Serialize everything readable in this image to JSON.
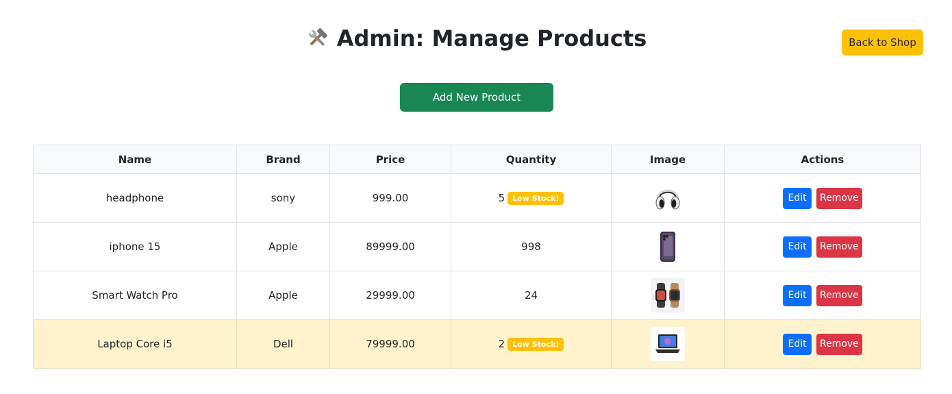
{
  "header": {
    "title": "Admin: Manage Products",
    "icon": "hammer-and-wrench-icon",
    "back_label": "Back to Shop"
  },
  "toolbar": {
    "add_label": "Add New Product"
  },
  "table": {
    "columns": [
      "Name",
      "Brand",
      "Price",
      "Quantity",
      "Image",
      "Actions"
    ],
    "rows": [
      {
        "name": "headphone",
        "brand": "sony",
        "price": "999.00",
        "quantity": "5",
        "badge": "Low Stock!",
        "image": "headphone-image",
        "edit": "Edit",
        "remove": "Remove"
      },
      {
        "name": "iphone 15",
        "brand": "Apple",
        "price": "89999.00",
        "quantity": "998",
        "badge": "",
        "image": "iphone-image",
        "edit": "Edit",
        "remove": "Remove"
      },
      {
        "name": "Smart Watch Pro",
        "brand": "Apple",
        "price": "29999.00",
        "quantity": "24",
        "badge": "",
        "image": "smart-watch-image",
        "edit": "Edit",
        "remove": "Remove"
      },
      {
        "name": "Laptop Core i5",
        "brand": "Dell",
        "price": "79999.00",
        "quantity": "2",
        "badge": "Low Stock!",
        "image": "laptop-image",
        "edit": "Edit",
        "remove": "Remove"
      }
    ]
  },
  "colors": {
    "back_button": "#ffc107",
    "add_button": "#198754",
    "edit_button": "#0d6efd",
    "remove_button": "#dc3545",
    "low_stock_badge": "#ffc107",
    "highlight_row": "#fff3cd"
  }
}
